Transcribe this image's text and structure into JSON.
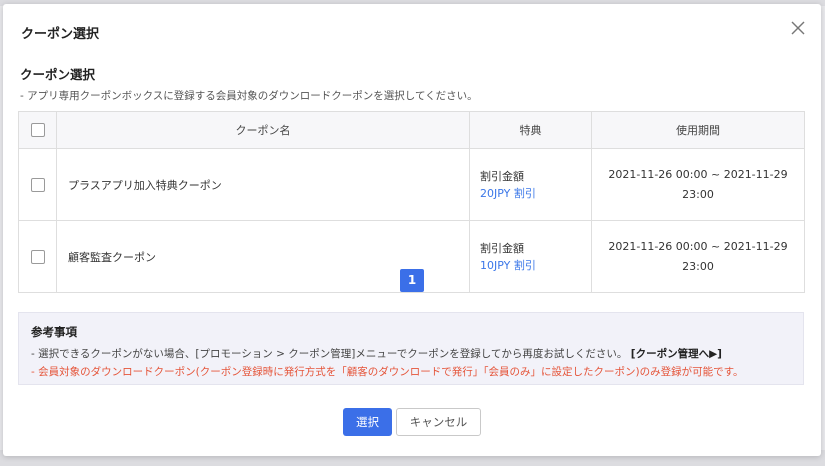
{
  "modal": {
    "title": "クーポン選択",
    "section_title": "クーポン選択",
    "description": "- アプリ専用クーポンボックスに登録する会員対象のダウンロードクーポンを選択してください。"
  },
  "table": {
    "headers": [
      "クーポン名",
      "特典",
      "使用期間"
    ],
    "rows": [
      {
        "name": "プラスアプリ加入特典クーポン",
        "benefit_label": "割引金額",
        "benefit_value": "20JPY 割引",
        "period_line1": "2021-11-26 00:00 ~ 2021-11-29",
        "period_line2": "23:00"
      },
      {
        "name": "顧客監査クーポン",
        "benefit_label": "割引金額",
        "benefit_value": "10JPY 割引",
        "period_line1": "2021-11-26 00:00 ~ 2021-11-29",
        "period_line2": "23:00"
      }
    ]
  },
  "pagination": {
    "current_page": "1"
  },
  "notes": {
    "title": "参考事項",
    "note1": "- 選択できるクーポンがない場合、[プロモーション > クーポン管理]メニューでクーポンを登録してから再度お試しください。",
    "note1_link": "[クーポン管理へ▶]",
    "note2": "- 会員対象のダウンロードクーポン(クーポン登録時に発行方式を「顧客のダウンロードで発行」「会員のみ」に設定したクーポン)のみ登録が可能です。"
  },
  "buttons": {
    "select": "選択",
    "cancel": "キャンセル"
  },
  "colors": {
    "primary": "#3b6fe8",
    "link": "#3b77e8",
    "warning": "#e5553a",
    "notes_bg": "#f2f2f9"
  },
  "icons": {
    "close": "close-icon",
    "checkbox": "checkbox"
  }
}
